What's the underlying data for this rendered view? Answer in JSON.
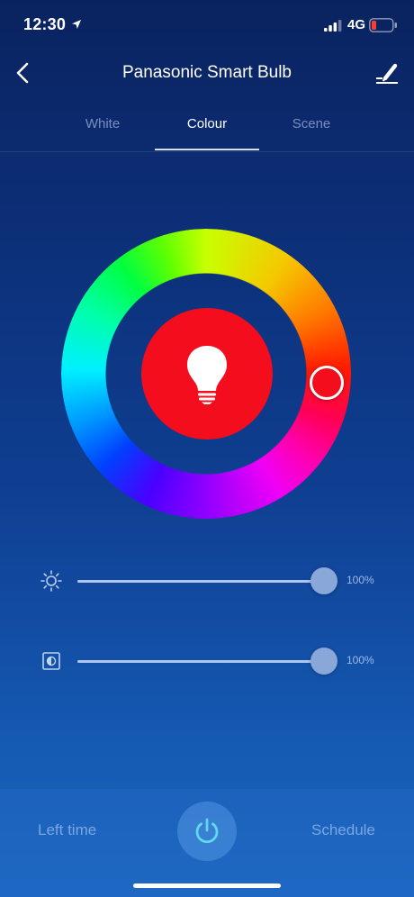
{
  "status_bar": {
    "time": "12:30",
    "network": "4G",
    "location_icon": "location-arrow-icon",
    "signal_icon": "signal-bars-icon",
    "battery_icon": "battery-low-icon",
    "battery_color": "#ff3b30"
  },
  "header": {
    "title": "Panasonic Smart Bulb",
    "back_icon": "chevron-left-icon",
    "edit_icon": "pencil-icon"
  },
  "tabs": [
    {
      "label": "White",
      "active": false
    },
    {
      "label": "Colour",
      "active": true
    },
    {
      "label": "Scene",
      "active": false
    }
  ],
  "color_wheel": {
    "selected_color": "#f40d1c",
    "bulb_icon": "light-bulb-icon"
  },
  "sliders": [
    {
      "icon": "brightness-sun-icon",
      "value_label": "100%",
      "value": 100
    },
    {
      "icon": "saturation-icon",
      "value_label": "100%",
      "value": 100
    }
  ],
  "bottom_bar": {
    "left_label": "Left time",
    "right_label": "Schedule",
    "power_icon": "power-icon",
    "power_color": "#5fd8f0"
  }
}
